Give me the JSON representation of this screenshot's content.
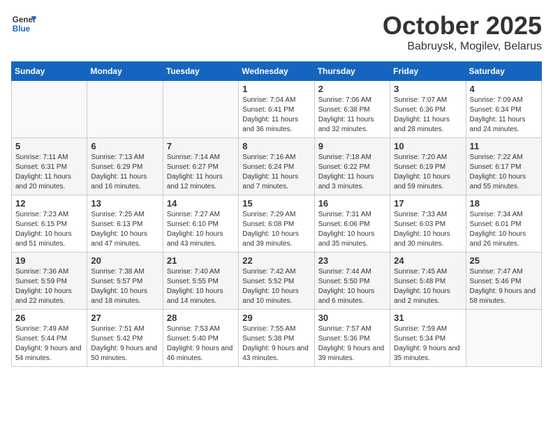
{
  "header": {
    "logo_line1": "General",
    "logo_line2": "Blue",
    "month": "October 2025",
    "location": "Babruysk, Mogilev, Belarus"
  },
  "days_of_week": [
    "Sunday",
    "Monday",
    "Tuesday",
    "Wednesday",
    "Thursday",
    "Friday",
    "Saturday"
  ],
  "weeks": [
    [
      {
        "day": "",
        "info": ""
      },
      {
        "day": "",
        "info": ""
      },
      {
        "day": "",
        "info": ""
      },
      {
        "day": "1",
        "info": "Sunrise: 7:04 AM\nSunset: 6:41 PM\nDaylight: 11 hours and 36 minutes."
      },
      {
        "day": "2",
        "info": "Sunrise: 7:06 AM\nSunset: 6:38 PM\nDaylight: 11 hours and 32 minutes."
      },
      {
        "day": "3",
        "info": "Sunrise: 7:07 AM\nSunset: 6:36 PM\nDaylight: 11 hours and 28 minutes."
      },
      {
        "day": "4",
        "info": "Sunrise: 7:09 AM\nSunset: 6:34 PM\nDaylight: 11 hours and 24 minutes."
      }
    ],
    [
      {
        "day": "5",
        "info": "Sunrise: 7:11 AM\nSunset: 6:31 PM\nDaylight: 11 hours and 20 minutes."
      },
      {
        "day": "6",
        "info": "Sunrise: 7:13 AM\nSunset: 6:29 PM\nDaylight: 11 hours and 16 minutes."
      },
      {
        "day": "7",
        "info": "Sunrise: 7:14 AM\nSunset: 6:27 PM\nDaylight: 11 hours and 12 minutes."
      },
      {
        "day": "8",
        "info": "Sunrise: 7:16 AM\nSunset: 6:24 PM\nDaylight: 11 hours and 7 minutes."
      },
      {
        "day": "9",
        "info": "Sunrise: 7:18 AM\nSunset: 6:22 PM\nDaylight: 11 hours and 3 minutes."
      },
      {
        "day": "10",
        "info": "Sunrise: 7:20 AM\nSunset: 6:19 PM\nDaylight: 10 hours and 59 minutes."
      },
      {
        "day": "11",
        "info": "Sunrise: 7:22 AM\nSunset: 6:17 PM\nDaylight: 10 hours and 55 minutes."
      }
    ],
    [
      {
        "day": "12",
        "info": "Sunrise: 7:23 AM\nSunset: 6:15 PM\nDaylight: 10 hours and 51 minutes."
      },
      {
        "day": "13",
        "info": "Sunrise: 7:25 AM\nSunset: 6:13 PM\nDaylight: 10 hours and 47 minutes."
      },
      {
        "day": "14",
        "info": "Sunrise: 7:27 AM\nSunset: 6:10 PM\nDaylight: 10 hours and 43 minutes."
      },
      {
        "day": "15",
        "info": "Sunrise: 7:29 AM\nSunset: 6:08 PM\nDaylight: 10 hours and 39 minutes."
      },
      {
        "day": "16",
        "info": "Sunrise: 7:31 AM\nSunset: 6:06 PM\nDaylight: 10 hours and 35 minutes."
      },
      {
        "day": "17",
        "info": "Sunrise: 7:33 AM\nSunset: 6:03 PM\nDaylight: 10 hours and 30 minutes."
      },
      {
        "day": "18",
        "info": "Sunrise: 7:34 AM\nSunset: 6:01 PM\nDaylight: 10 hours and 26 minutes."
      }
    ],
    [
      {
        "day": "19",
        "info": "Sunrise: 7:36 AM\nSunset: 5:59 PM\nDaylight: 10 hours and 22 minutes."
      },
      {
        "day": "20",
        "info": "Sunrise: 7:38 AM\nSunset: 5:57 PM\nDaylight: 10 hours and 18 minutes."
      },
      {
        "day": "21",
        "info": "Sunrise: 7:40 AM\nSunset: 5:55 PM\nDaylight: 10 hours and 14 minutes."
      },
      {
        "day": "22",
        "info": "Sunrise: 7:42 AM\nSunset: 5:52 PM\nDaylight: 10 hours and 10 minutes."
      },
      {
        "day": "23",
        "info": "Sunrise: 7:44 AM\nSunset: 5:50 PM\nDaylight: 10 hours and 6 minutes."
      },
      {
        "day": "24",
        "info": "Sunrise: 7:45 AM\nSunset: 5:48 PM\nDaylight: 10 hours and 2 minutes."
      },
      {
        "day": "25",
        "info": "Sunrise: 7:47 AM\nSunset: 5:46 PM\nDaylight: 9 hours and 58 minutes."
      }
    ],
    [
      {
        "day": "26",
        "info": "Sunrise: 7:49 AM\nSunset: 5:44 PM\nDaylight: 9 hours and 54 minutes."
      },
      {
        "day": "27",
        "info": "Sunrise: 7:51 AM\nSunset: 5:42 PM\nDaylight: 9 hours and 50 minutes."
      },
      {
        "day": "28",
        "info": "Sunrise: 7:53 AM\nSunset: 5:40 PM\nDaylight: 9 hours and 46 minutes."
      },
      {
        "day": "29",
        "info": "Sunrise: 7:55 AM\nSunset: 5:38 PM\nDaylight: 9 hours and 43 minutes."
      },
      {
        "day": "30",
        "info": "Sunrise: 7:57 AM\nSunset: 5:36 PM\nDaylight: 9 hours and 39 minutes."
      },
      {
        "day": "31",
        "info": "Sunrise: 7:59 AM\nSunset: 5:34 PM\nDaylight: 9 hours and 35 minutes."
      },
      {
        "day": "",
        "info": ""
      }
    ]
  ]
}
